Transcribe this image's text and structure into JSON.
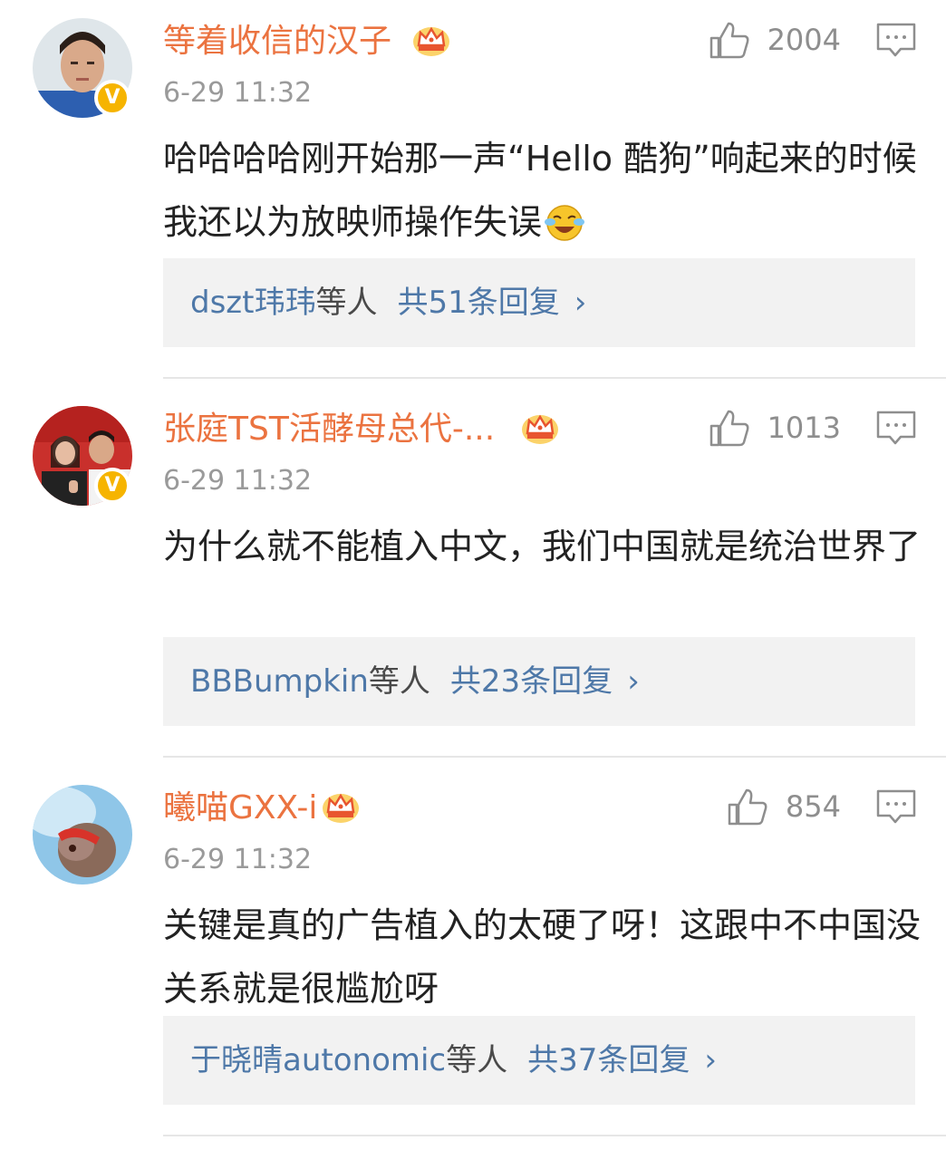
{
  "comments": [
    {
      "username": "等着收信的汉子",
      "time": "6-29 11:32",
      "likes": "2004",
      "text": "哈哈哈哈刚开始那一声“Hello 酷狗”响起来的时候我还以为放映师操作失误",
      "emoji": "laughing-crying-emoji",
      "reply_user": "dszt玮玮",
      "reply_suffix": "等人",
      "reply_count": "共51条回复",
      "chevron": "›",
      "verified": "V"
    },
    {
      "username": "张庭TST活酵母总代-...",
      "time": "6-29 11:32",
      "likes": "1013",
      "text": "为什么就不能植入中文，我们中国就是统治世界了",
      "reply_user": "BBBumpkin",
      "reply_suffix": "等人",
      "reply_count": "共23条回复",
      "chevron": "›",
      "verified": "V"
    },
    {
      "username": "曦喵GXX-i",
      "time": "6-29 11:32",
      "likes": "854",
      "text": "关键是真的广告植入的太硬了呀！这跟中不中国没关系就是很尴尬呀",
      "reply_user": "于晓晴autonomic",
      "reply_suffix": "等人",
      "reply_count": "共37条回复",
      "chevron": "›"
    }
  ],
  "colors": {
    "username": "#eb7340",
    "link": "#4e78a8",
    "verified_badge": "#f6b400",
    "reply_bg": "#f2f2f2"
  }
}
